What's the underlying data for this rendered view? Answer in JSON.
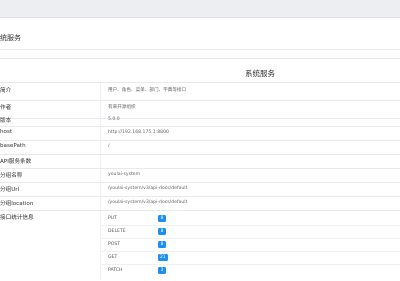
{
  "page": {
    "title": "统服务"
  },
  "card": {
    "title": "系统服务"
  },
  "rows": [
    {
      "label": "简介",
      "value": "用户、角色、菜单、部门、字典等接口"
    },
    {
      "label": "作者",
      "value": "有来开源组织"
    },
    {
      "label": "版本",
      "value": "5.0.0"
    },
    {
      "label": "host",
      "value": "http://192.168.175.1:8800"
    },
    {
      "label": "basePath",
      "value": "/"
    },
    {
      "label": "API服务条数",
      "value": ""
    },
    {
      "label": "分组名称",
      "value": "youlai-system"
    },
    {
      "label": "分组Url",
      "value": "/youlai-system/v3/api-docs/default"
    },
    {
      "label": "分组location",
      "value": "/youlai-system/v3/api-docs/default"
    },
    {
      "label": "接口统计信息",
      "value": ""
    }
  ],
  "stats": [
    {
      "method": "PUT",
      "count": "8"
    },
    {
      "method": "DELETE",
      "count": "8"
    },
    {
      "method": "POST",
      "count": "8"
    },
    {
      "method": "GET",
      "count": "21"
    },
    {
      "method": "PATCH",
      "count": "3"
    }
  ],
  "colors": {
    "badge": "#1f8ef1",
    "topbar": "#eceef2",
    "border": "#e6e9ee"
  }
}
